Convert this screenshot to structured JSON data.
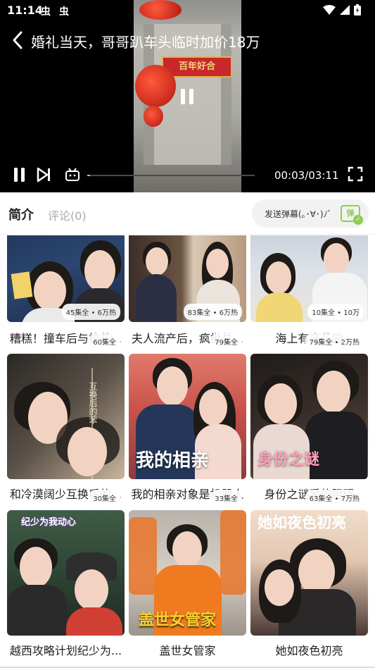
{
  "status_bar": {
    "time": "11:14",
    "notif_icons": [
      "虫",
      "虫"
    ]
  },
  "player": {
    "title": "婚礼当天，哥哥趴车头临时加价18万",
    "sign_text": "百年好合",
    "current_time": "00:03",
    "total_time": "03:11",
    "time_display": "00:03/03:11",
    "progress": 0.016
  },
  "tabs": {
    "intro": "简介",
    "comments": "评论(0)"
  },
  "danmaku": {
    "placeholder": "发送弹幕(｡･∀･)ﾉﾞ",
    "icon_label": "弹"
  },
  "dramas": [
    {
      "title": "糟糕！撞车后与校花...",
      "badge": "45集全 • 6万热",
      "cover_text": "",
      "colors": [
        "#1a2b4a",
        "#f4e3d8"
      ]
    },
    {
      "title": "夫人流产后，疯批总...",
      "badge": "83集全 • 6万热",
      "cover_text": "",
      "colors": [
        "#3a2f2a",
        "#d8c7b6"
      ]
    },
    {
      "title": "海上有座花园",
      "badge": "10集全 • 10万",
      "cover_text": "",
      "colors": [
        "#c7ccd4",
        "#e8d8a8"
      ]
    },
    {
      "title": "和冷漠阔少互换后的...",
      "badge": "60集全",
      "cover_text": "互换后的苯",
      "colors": [
        "#3b3834",
        "#d9c9b5"
      ]
    },
    {
      "title": "我的相亲对象是机器人",
      "badge": "79集全",
      "cover_text": "我的相亲",
      "colors": [
        "#d15a55",
        "#2e3b5c"
      ]
    },
    {
      "title": "身份之谜爱的阻碍",
      "badge": "79集全 • 2万热",
      "cover_text": "身份之谜",
      "colors": [
        "#2a2420",
        "#e8c9b8"
      ]
    },
    {
      "title": "越西攻略计划纪少为...",
      "badge": "30集全",
      "cover_text": "纪少为我动心",
      "colors": [
        "#2f4a3a",
        "#d84a3a"
      ]
    },
    {
      "title": "盖世女管家",
      "badge": "33集全",
      "cover_text": "盖世女管家",
      "colors": [
        "#c9c0b5",
        "#f07a20"
      ]
    },
    {
      "title": "她如夜色初亮",
      "badge": "63集全 • 7万热",
      "cover_text": "她如夜色初亮",
      "colors": [
        "#e9d3c2",
        "#2d2a2a"
      ]
    }
  ]
}
